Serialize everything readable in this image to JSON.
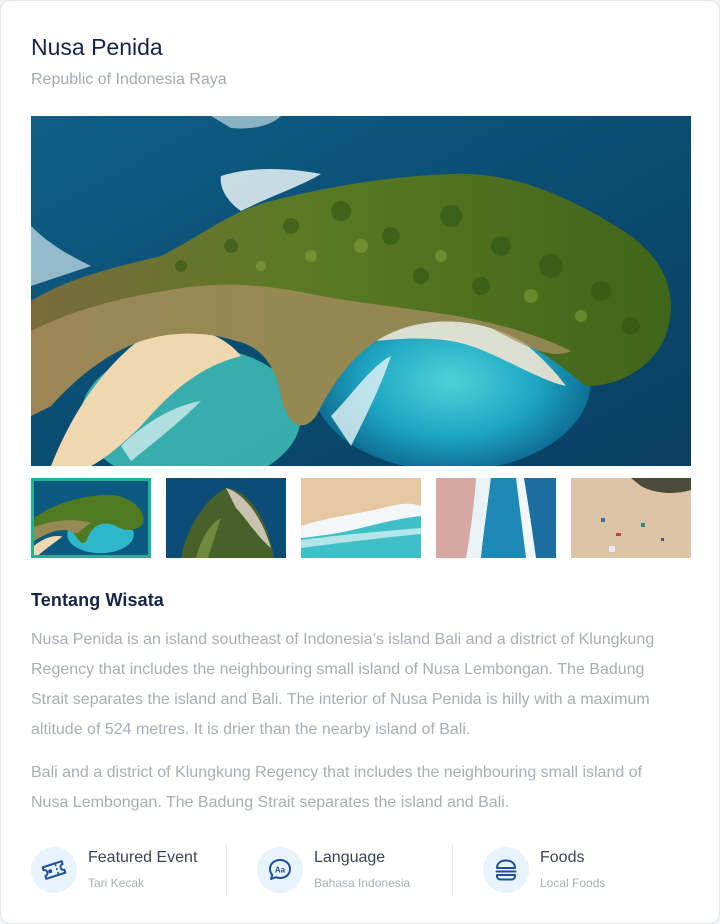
{
  "destination": {
    "title": "Nusa Penida",
    "subtitle": "Republic of Indonesia Raya"
  },
  "gallery": {
    "hero_alt": "Aerial view of Nusa Penida cliff",
    "thumbnails": [
      {
        "label": "aerial-cliff",
        "active": true
      },
      {
        "label": "rock-cliff",
        "active": false
      },
      {
        "label": "beach-waves",
        "active": false
      },
      {
        "label": "shoreline",
        "active": false
      },
      {
        "label": "sand-beach",
        "active": false
      }
    ]
  },
  "about": {
    "heading": "Tentang Wisata",
    "paragraphs": [
      "Nusa Penida is an island southeast of Indonesia’s island Bali and a district of Klungkung Regency that includes the neighbouring small island of Nusa Lembongan. The Badung Strait separates the island and Bali. The interior of Nusa Penida is hilly with a maximum altitude of 524 metres. It is drier than the nearby island of Bali.",
      "Bali and a district of Klungkung Regency that includes the neighbouring small island of Nusa Lembongan. The Badung Strait separates the island and Bali."
    ]
  },
  "features": [
    {
      "icon": "ticket-icon",
      "label": "Featured Event",
      "value": "Tari Kecak"
    },
    {
      "icon": "language-icon",
      "label": "Language",
      "value": "Bahasa Indonesia"
    },
    {
      "icon": "burger-icon",
      "label": "Foods",
      "value": "Local Foods"
    }
  ],
  "colors": {
    "accent": "#1fb49a",
    "title": "#14254a",
    "muted": "#a8adb6",
    "icon": "#1f4e9c",
    "icon_bg": "#e8f4fb"
  }
}
